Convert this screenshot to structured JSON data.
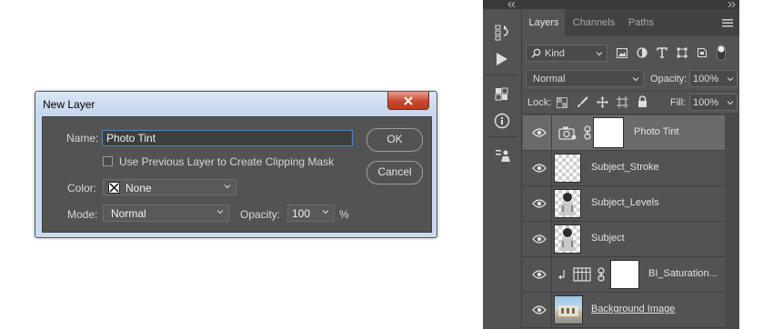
{
  "dialog": {
    "title": "New Layer",
    "name_label": "Name:",
    "name_value": "Photo Tint",
    "checkbox_label": "Use Previous Layer to Create Clipping Mask",
    "color_label": "Color:",
    "color_value": "None",
    "mode_label": "Mode:",
    "mode_value": "Normal",
    "opacity_label": "Opacity:",
    "opacity_value": "100",
    "opacity_unit": "%",
    "ok_label": "OK",
    "cancel_label": "Cancel"
  },
  "panel": {
    "tabs": [
      {
        "label": "Layers"
      },
      {
        "label": "Channels"
      },
      {
        "label": "Paths"
      }
    ],
    "filter_value": "Kind",
    "blend_mode": "Normal",
    "opacity_label": "Opacity:",
    "opacity_value": "100%",
    "lock_label": "Lock:",
    "fill_label": "Fill:",
    "fill_value": "100%",
    "layers": [
      {
        "name": "Photo Tint",
        "selected": true
      },
      {
        "name": "Subject_Stroke"
      },
      {
        "name": "Subject_Levels"
      },
      {
        "name": "Subject"
      },
      {
        "name": "BI_Saturation..."
      },
      {
        "name": "Background Image"
      }
    ]
  },
  "colors": {
    "panel_bg": "#535353",
    "selected_row": "#6a6a6a",
    "focus_border": "#4e86c8",
    "close_button": "#c7472f"
  }
}
